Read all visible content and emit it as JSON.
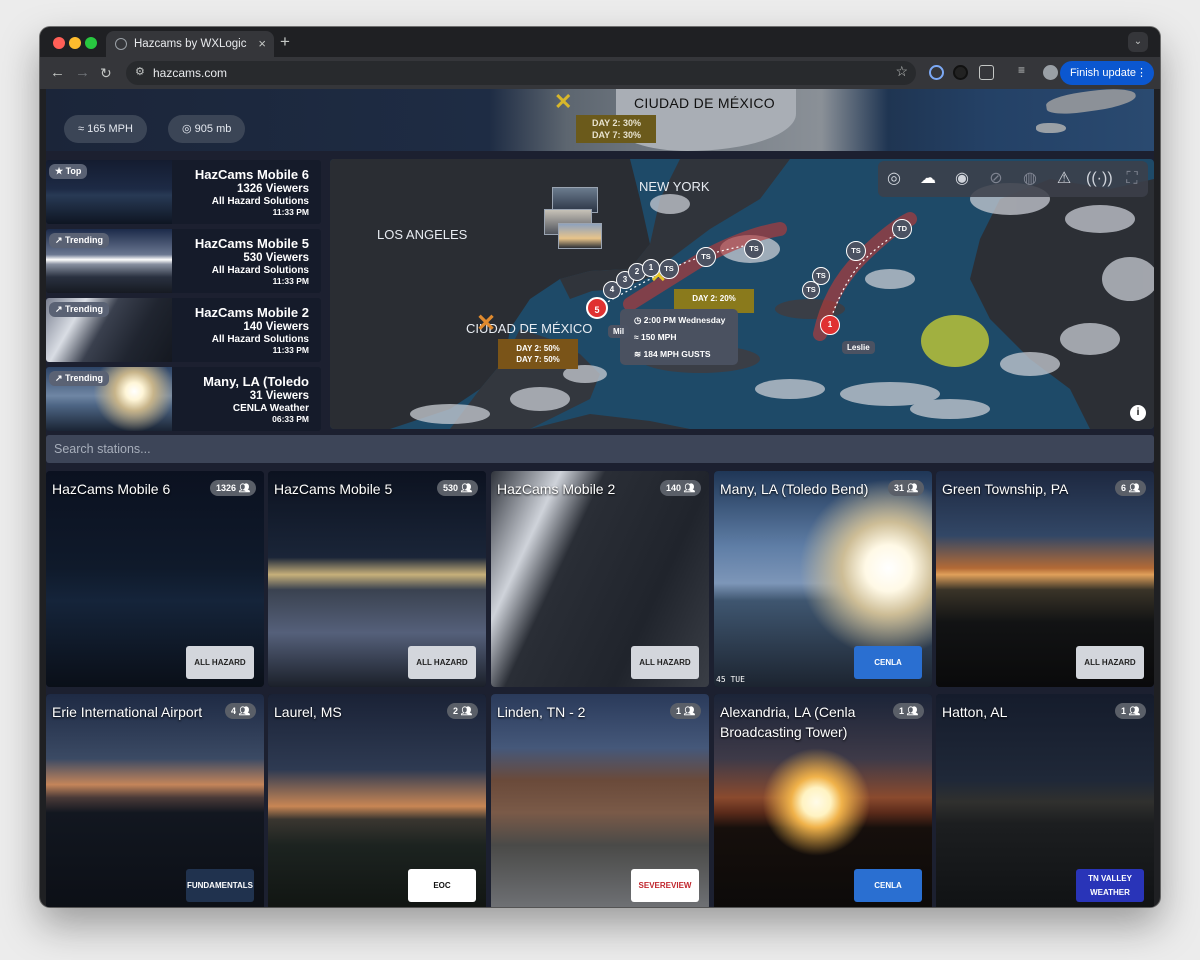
{
  "browser": {
    "tab_title": "Hazcams by WXLogic",
    "close_tab": "×",
    "new_tab": "+",
    "url": "hazcams.com",
    "update_label": "Finish update",
    "traffic_colors": [
      "#ff5f57",
      "#febc2e",
      "#28c840"
    ]
  },
  "top_strip": {
    "wind": "165 MPH",
    "pressure": "905 mb",
    "city_label": "CIUDAD DE MÉXICO",
    "outlook": [
      "DAY 2: 30%",
      "DAY 7: 30%"
    ]
  },
  "featured": [
    {
      "badge": "★ Top",
      "name": "HazCams Mobile 6",
      "viewers": "1326 Viewers",
      "owner": "All Hazard Solutions",
      "time": "11:33 PM"
    },
    {
      "badge": "↗ Trending",
      "name": "HazCams Mobile 5",
      "viewers": "530 Viewers",
      "owner": "All Hazard Solutions",
      "time": "11:33 PM"
    },
    {
      "badge": "↗ Trending",
      "name": "HazCams Mobile 2",
      "viewers": "140 Viewers",
      "owner": "All Hazard Solutions",
      "time": "11:33 PM"
    },
    {
      "badge": "↗ Trending",
      "name": "Many, LA (Toledo",
      "viewers": "31 Viewers",
      "owner": "CENLA Weather",
      "time": "06:33 PM"
    }
  ],
  "map": {
    "labels": {
      "los_angeles": "LOS ANGELES",
      "new_york": "NEW YORK",
      "mexico": "CIUDAD DE MÉXICO",
      "storm_name_1": "Leslie",
      "storm_name_2": "Mil"
    },
    "outlook_gulf": [
      "DAY 2: 20%"
    ],
    "outlook_mexico": [
      "DAY 2: 50%",
      "DAY 7: 50%"
    ],
    "storm_card": {
      "time": "2:00 PM Wednesday",
      "wind": "150 MPH",
      "gusts": "184 MPH GUSTS"
    },
    "track_markers": {
      "ts": "TS",
      "td": "TD",
      "cat5": "5",
      "cat4": "4",
      "cat3": "3",
      "cat2": "2",
      "cat1": "1"
    },
    "info": "i"
  },
  "search": {
    "placeholder": "Search stations..."
  },
  "stations": [
    {
      "name": "HazCams Mobile 6",
      "viewers": "1326",
      "logo": "ALL HAZARD"
    },
    {
      "name": "HazCams Mobile 5",
      "viewers": "530",
      "logo": "ALL HAZARD"
    },
    {
      "name": "HazCams Mobile 2",
      "viewers": "140",
      "logo": "ALL HAZARD"
    },
    {
      "name": "Many, LA (Toledo Bend)",
      "viewers": "31",
      "logo": "CENLA WEATHER"
    },
    {
      "name": "Green Township, PA",
      "viewers": "6",
      "logo": "ALL HAZARD"
    },
    {
      "name": "Erie International Airport",
      "viewers": "4",
      "logo": "FUNDAMENTALS"
    },
    {
      "name": "Laurel, MS",
      "viewers": "2",
      "logo": "EOC"
    },
    {
      "name": "Linden, TN - 2",
      "viewers": "1",
      "logo": "SEVEREVIEW"
    },
    {
      "name": "Alexandria, LA (Cenla Broadcasting Tower)",
      "viewers": "1",
      "logo": "CENLA WEATHER"
    },
    {
      "name": "Hatton, AL",
      "viewers": "1",
      "logo": "TN VALLEY WEATHER"
    }
  ],
  "overlay_text": {
    "cam_timestamp": "45 TUE"
  },
  "colors": {
    "accent": "#0b57d0",
    "page_bg": "#1c2030",
    "hurricane_red": "#e03131",
    "outlook_brown": "#7a5418"
  }
}
